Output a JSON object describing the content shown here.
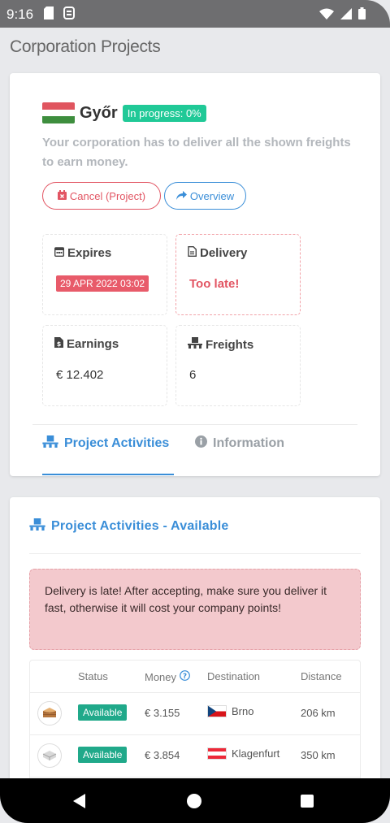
{
  "status_bar": {
    "time": "9:16"
  },
  "page": {
    "title": "Corporation Projects"
  },
  "project": {
    "city": "Győr",
    "progress_badge": "In progress: 0%",
    "description": "Your corporation has to deliver all the shown freights to earn money.",
    "cancel_label": "Cancel (Project)",
    "overview_label": "Overview",
    "flag_colors": [
      "#e0555f",
      "#ffffff",
      "#3e8e3e"
    ],
    "expires": {
      "label": "Expires",
      "value": "29 APR 2022 03:02"
    },
    "delivery": {
      "label": "Delivery",
      "value": "Too late!"
    },
    "earnings": {
      "label": "Earnings",
      "value": "€ 12.402"
    },
    "freights": {
      "label": "Freights",
      "value": "6"
    }
  },
  "tabs": [
    {
      "label": "Project Activities",
      "active": true
    },
    {
      "label": "Information",
      "active": false
    }
  ],
  "activities": {
    "title": "Project Activities - Available",
    "alert": "Delivery is late! After accepting, make sure you deliver it fast, otherwise it will cost your company points!",
    "columns": [
      "Status",
      "Money",
      "Destination",
      "Distance"
    ],
    "rows": [
      {
        "status": "Available",
        "money": "€ 3.155",
        "destination": "Brno",
        "distance": "206 km",
        "flag": "cz"
      },
      {
        "status": "Available",
        "money": "€ 3.854",
        "destination": "Klagenfurt",
        "distance": "350 km",
        "flag": "at"
      }
    ]
  },
  "colors": {
    "accent": "#3a8ed8",
    "success": "#20c997",
    "danger": "#e25563"
  }
}
